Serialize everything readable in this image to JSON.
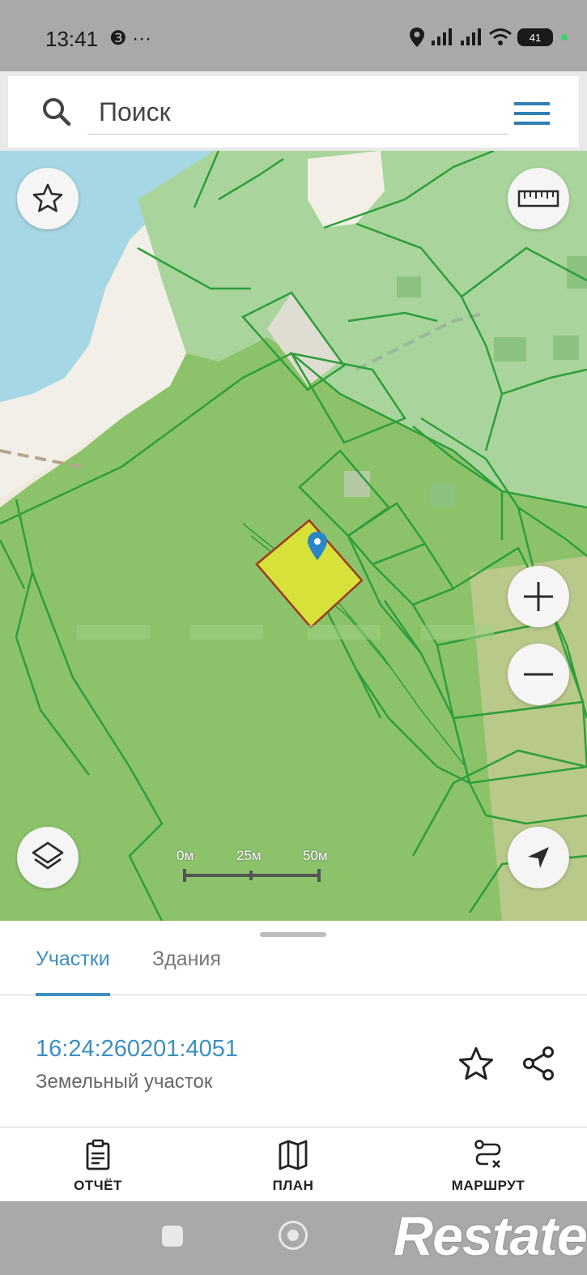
{
  "status_bar": {
    "time": "13:41",
    "left_icons": "❸ ···",
    "battery": "41",
    "icons": [
      "location-pin-icon",
      "signal-icon",
      "signal-icon",
      "wifi-icon",
      "battery-icon"
    ]
  },
  "search": {
    "placeholder": "Поиск",
    "menu_icon": "hamburger-menu-icon"
  },
  "map": {
    "controls": {
      "favorite": "star-icon",
      "ruler": "ruler-icon",
      "zoom_in": "plus-icon",
      "zoom_out": "minus-icon",
      "layers": "layers-icon",
      "locate": "navigation-arrow-icon"
    },
    "scale": [
      "0м",
      "25м",
      "50м"
    ],
    "colors": {
      "water": "#a6d7e4",
      "forest": "#8cc36a",
      "selected_parcel": "#d6e23a",
      "parcel_border": "#2e9e3a"
    }
  },
  "sheet": {
    "tabs": [
      "Участки",
      "Здания"
    ],
    "active_tab": "Участки",
    "parcel_id": "16:24:260201:4051",
    "parcel_type": "Земельный участок"
  },
  "actions": [
    {
      "label": "ОТЧЁТ",
      "icon": "report-clipboard-icon"
    },
    {
      "label": "ПЛАН",
      "icon": "map-plan-icon"
    },
    {
      "label": "МАРШРУТ",
      "icon": "route-icon"
    }
  ],
  "watermark": "Restate",
  "accent_color": "#3d8fc2"
}
